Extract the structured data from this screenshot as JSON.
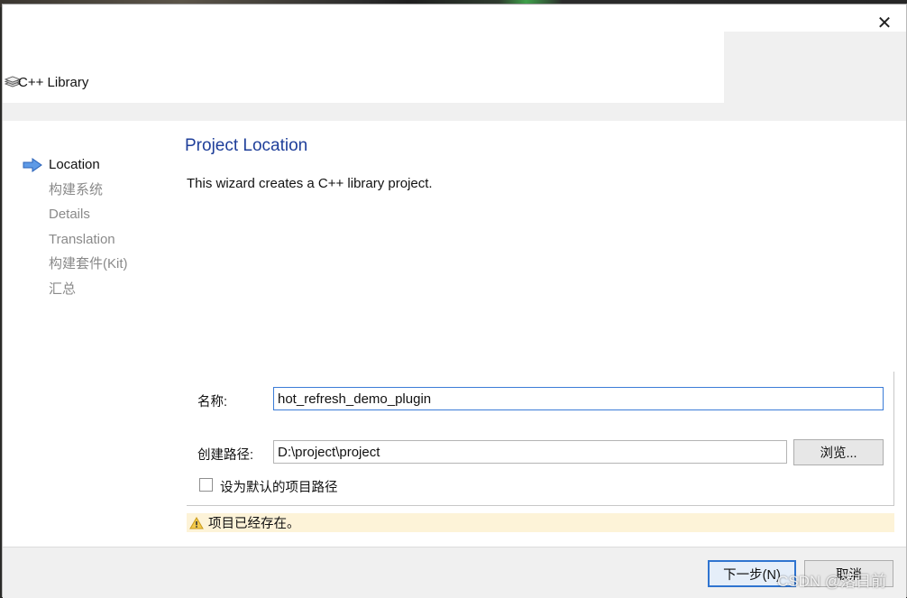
{
  "window": {
    "close_glyph": "✕",
    "wizard_title": "C++ Library",
    "wizard_icon": "library-stack-icon"
  },
  "steps": [
    {
      "label": "Location",
      "active": true
    },
    {
      "label": "构建系统",
      "active": false
    },
    {
      "label": "Details",
      "active": false
    },
    {
      "label": "Translation",
      "active": false
    },
    {
      "label": "构建套件(Kit)",
      "active": false
    },
    {
      "label": "汇总",
      "active": false
    }
  ],
  "page": {
    "title": "Project Location",
    "description": "This wizard creates a C++ library project."
  },
  "form": {
    "name_label": "名称:",
    "name_value": "hot_refresh_demo_plugin",
    "path_label": "创建路径:",
    "path_value": "D:\\project\\project",
    "browse_label": "浏览...",
    "default_path_label": "设为默认的项目路径",
    "default_path_checked": false
  },
  "warning": {
    "icon": "warning-triangle-icon",
    "text": "项目已经存在。"
  },
  "footer": {
    "next_label": "下一步(N)",
    "cancel_label": "取消"
  },
  "watermark": "CSDN @落日前",
  "colors": {
    "title_blue": "#1f3f9a",
    "warning_bg": "#fdf3d8",
    "focus_border": "#3b7cd7",
    "step_arrow": "#3c7fd6"
  }
}
